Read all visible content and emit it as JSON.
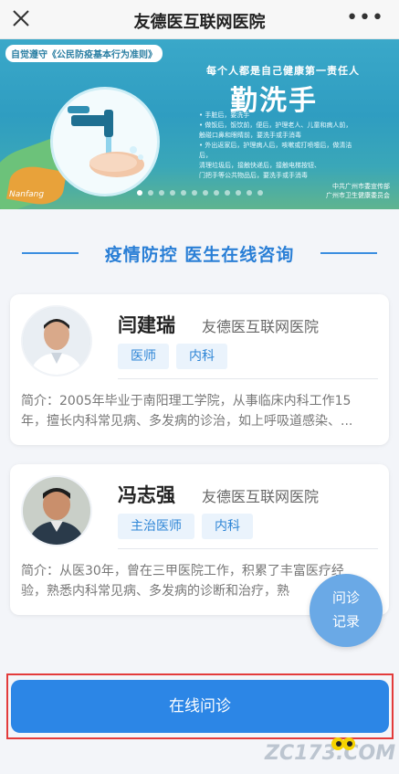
{
  "topbar": {
    "title": "友德医互联网医院",
    "more_label": "•••"
  },
  "banner": {
    "tag": "自觉遵守《公民防疫基本行为准则》",
    "slogan": "每个人都是自己健康第一责任人",
    "headline": "勤洗手",
    "bullets": [
      "• 手脏后，要洗手",
      "• 做饭后，饭饮前，便后，护理老人、儿童和病人前，",
      "  触碰口鼻和眼睛前，要洗手或手消毒",
      "• 外出返家后，护理病人后，咳嗽或打喷嚏后，做清洁后，",
      "  清理垃圾后，接触快递后，接触电梯按钮、",
      "  门把手等公共物品后，要洗手或手消毒"
    ],
    "credit": [
      "中共广州市委宣传部",
      "广州市卫生健康委员会"
    ],
    "signature": "Nanfang",
    "active_slide": 1,
    "slide_count": 12
  },
  "section": {
    "title": "疫情防控  医生在线咨询"
  },
  "doctors": [
    {
      "name": "闫建瑞",
      "hospital": "友德医互联网医院",
      "tags": [
        "医师",
        "内科"
      ],
      "intro_lines": [
        "简介：2005年毕业于南阳理工学院，从事临床内科工作15",
        "年，擅长内科常见病、多发病的诊治，如上呼吸道感染、..."
      ]
    },
    {
      "name": "冯志强",
      "hospital": "友德医互联网医院",
      "tags": [
        "主治医师",
        "内科"
      ],
      "intro_lines": [
        "简介：从医30年，曾在三甲医院工作，积累了丰富医疗经",
        "验，熟悉内科常见病、多发病的诊断和治疗，熟"
      ]
    }
  ],
  "fab": {
    "line1": "问诊",
    "line2": "记录"
  },
  "bottom": {
    "button_label": "在线问诊"
  },
  "watermark": "ZC173.COM",
  "colors": {
    "accent": "#2c86e6",
    "tag_bg": "#eaf3fc",
    "highlight_frame": "#e33b3b"
  }
}
